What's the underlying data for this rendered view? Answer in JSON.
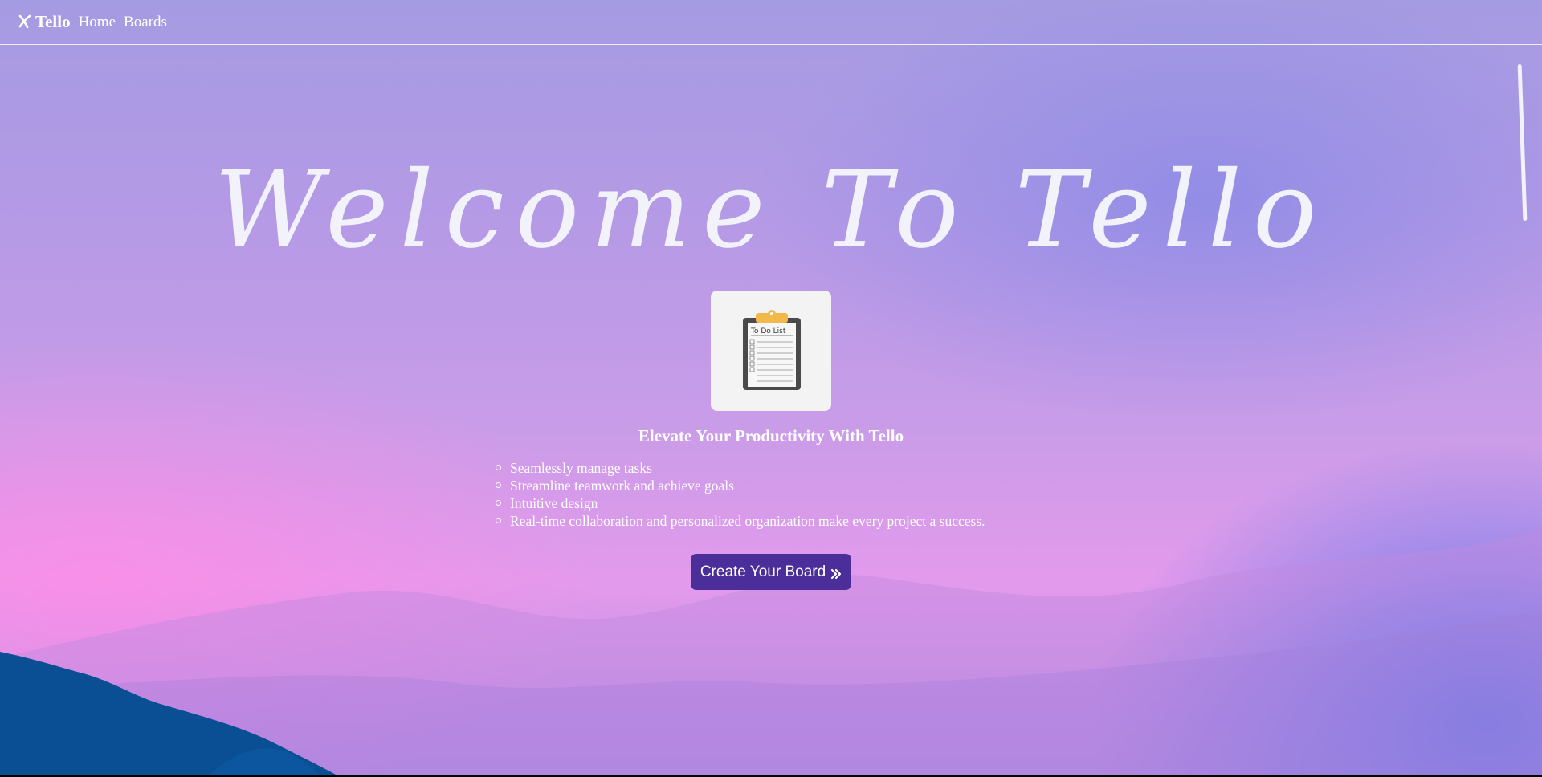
{
  "navbar": {
    "brand": "Tello",
    "brand_icon": "x-logo-icon",
    "links": [
      "Home",
      "Boards"
    ]
  },
  "hero": {
    "title": "Welcome To Tello",
    "logo_text": "To Do List",
    "logo_icon": "clipboard-icon"
  },
  "content": {
    "tagline": "Elevate Your Productivity With Tello",
    "features": [
      "Seamlessly manage tasks",
      "Streamline teamwork and achieve goals",
      "Intuitive design",
      "Real-time collaboration and personalized organization make every project a success."
    ],
    "cta_label": "Create Your Board",
    "cta_icon": "double-chevron-right-icon"
  },
  "colors": {
    "cta_background": "#4b2e9a",
    "text": "#ffffff"
  }
}
